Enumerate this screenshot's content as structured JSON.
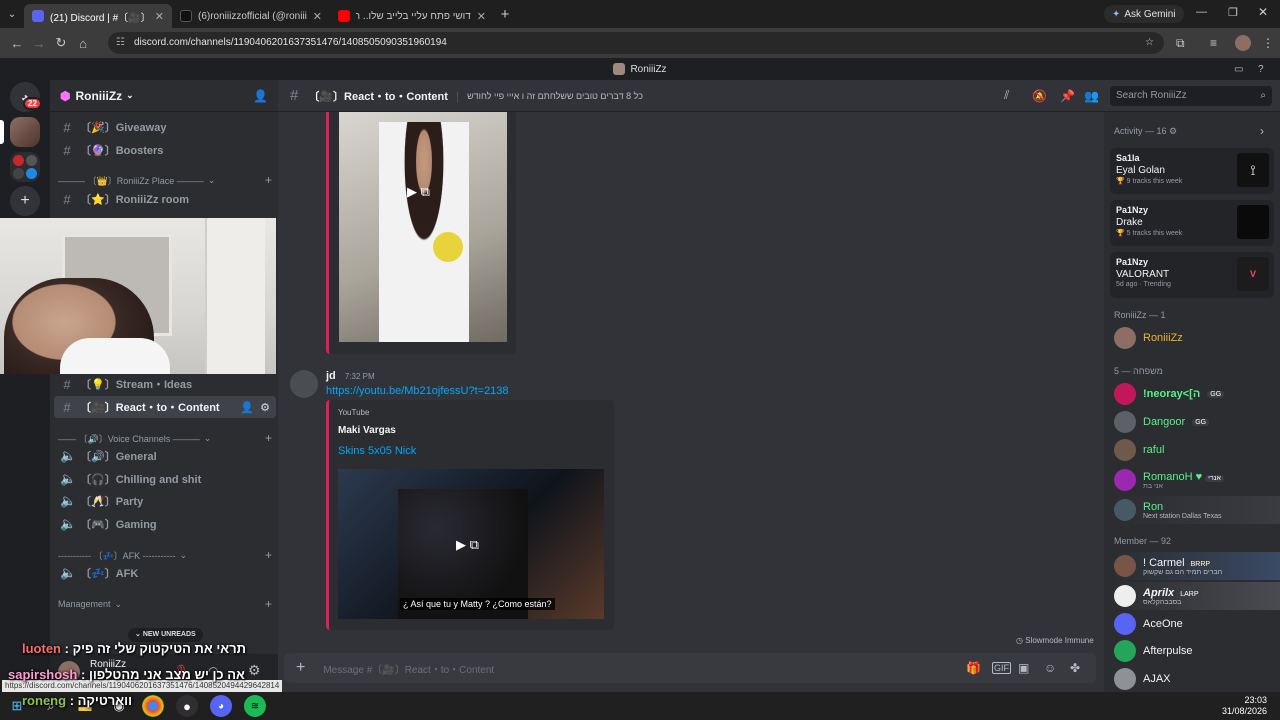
{
  "browser": {
    "tabs": [
      {
        "label": "(21) Discord | #〔🎥〕React・to・Con",
        "color": "#5865f2"
      },
      {
        "label": "(6)roniiizzofficial (@roniiizzoffic",
        "color": "#111111"
      },
      {
        "label": "דושי פתח עליי בלייב שלו.. הייתי",
        "color": "#ff0000"
      }
    ],
    "ask_gemini": "Ask Gemini",
    "url": "discord.com/channels/1190406201637351476/1408505090351960194"
  },
  "discord": {
    "window_title": "RoniiiZz",
    "rail_badge": "22",
    "server_name": "RoniiiZz",
    "channels": [
      {
        "icon": "#",
        "label": "〔🎉〕Giveaway"
      },
      {
        "icon": "#",
        "label": "〔🔮〕Boosters"
      },
      {
        "icon": "#",
        "label": "〔⭐〕RoniiiZz room"
      },
      {
        "icon": "#",
        "label": "〔💡〕Stream・Ideas"
      },
      {
        "icon": "#",
        "label": "〔🎥〕React・to・Content"
      },
      {
        "icon": "🔊",
        "label": "〔🔊〕General"
      },
      {
        "icon": "🔊",
        "label": "〔🎧〕Chilling and shit"
      },
      {
        "icon": "🔊",
        "label": "〔🥂〕Party"
      },
      {
        "icon": "🔊",
        "label": "〔🎮〕Gaming"
      },
      {
        "icon": "🔊",
        "label": "〔💤〕AFK"
      }
    ],
    "categories": {
      "place": "——— 〔👑〕RoniiiZz Place ———",
      "voice": "—— 〔🔊〕Voice Channels ———",
      "afk": "----------- 〔💤〕AFK -----------",
      "management": "Management"
    },
    "new_unreads": "NEW UNREADS",
    "user_name": "RoniiiZz",
    "hover_url": "https://discord.com/channels/1190406201637351476/1408520494429642814",
    "channel_header": {
      "name": "〔🎥〕React・to・Content",
      "topic": "כל 8 דברים טובים ששלחתם זה ו אייי פיי לחודש"
    },
    "search_placeholder": "Search RoniiiZz",
    "message": {
      "author": "jd",
      "time": "7:32 PM",
      "link": "https://youtu.be/Mb21ojfessU?t=2138",
      "embed_provider": "YouTube",
      "embed_author": "Maki Vargas",
      "embed_title": "Skins 5x05 Nick",
      "subtitle": "¿ Así que tu y Matty ? ¿Como están?"
    },
    "slowmode": "Slowmode Immune",
    "composer_placeholder": "Message #〔🎥〕React・to・Content",
    "activity": {
      "header": "Activity — 16",
      "items": [
        {
          "name": "Sa1la",
          "title": "Eyal Golan",
          "sub": "9 tracks this week"
        },
        {
          "name": "Pa1Nzy",
          "title": "Drake",
          "sub": "5 tracks this week"
        },
        {
          "name": "Pa1Nzy",
          "title": "VALORANT",
          "sub": "5d ago",
          "trend": "Trending"
        }
      ]
    },
    "member_sections": [
      {
        "header": "RoniiiZz — 1"
      },
      {
        "header": "משפחה — 5"
      },
      {
        "header": "Member — 92"
      }
    ],
    "members": [
      {
        "name": "RoniiiZz",
        "color": "#f0b232",
        "sub": ""
      },
      {
        "name": "!neoray<[ה",
        "color": "#57f287",
        "sub": "",
        "tag": "GG"
      },
      {
        "name": "Dangoor",
        "color": "#57f287",
        "sub": "",
        "tag": "GG"
      },
      {
        "name": "raful",
        "color": "#57f287",
        "sub": ""
      },
      {
        "name": "RomanoH ♥",
        "color": "#57f287",
        "sub": "אני בת",
        "tag": "אנרי"
      },
      {
        "name": "Ron",
        "color": "#57f287",
        "sub": "Next station Dallas Texas"
      },
      {
        "name": "! Carmel",
        "color": "#f2f3f5",
        "sub": "חברים תמיד הם גם שקשוק",
        "tag": "BRRP"
      },
      {
        "name": "Aprilx",
        "color": "#f2f3f5",
        "sub": "בסבבהקלאס",
        "tag": "LARP"
      },
      {
        "name": "AceOne",
        "color": "#f2f3f5",
        "sub": ""
      },
      {
        "name": "Afterpulse",
        "color": "#f2f3f5",
        "sub": ""
      },
      {
        "name": "AJAX",
        "color": "#f2f3f5",
        "sub": ""
      }
    ]
  },
  "overlay_chat": [
    {
      "user": "luoten",
      "text": ": תראי את הטיקטוק שלי זה פיק",
      "color": "#ff6b6b"
    },
    {
      "user": "sapirshosh",
      "text": ": אה כן יש מצב אני מהטלפון",
      "color": "#ff9ad5"
    },
    {
      "user": "roneng",
      "text": ": ווארטיקה",
      "color": "#8bc34a"
    }
  ],
  "taskbar": {
    "time": "23:03",
    "date": "31/08/2026"
  }
}
